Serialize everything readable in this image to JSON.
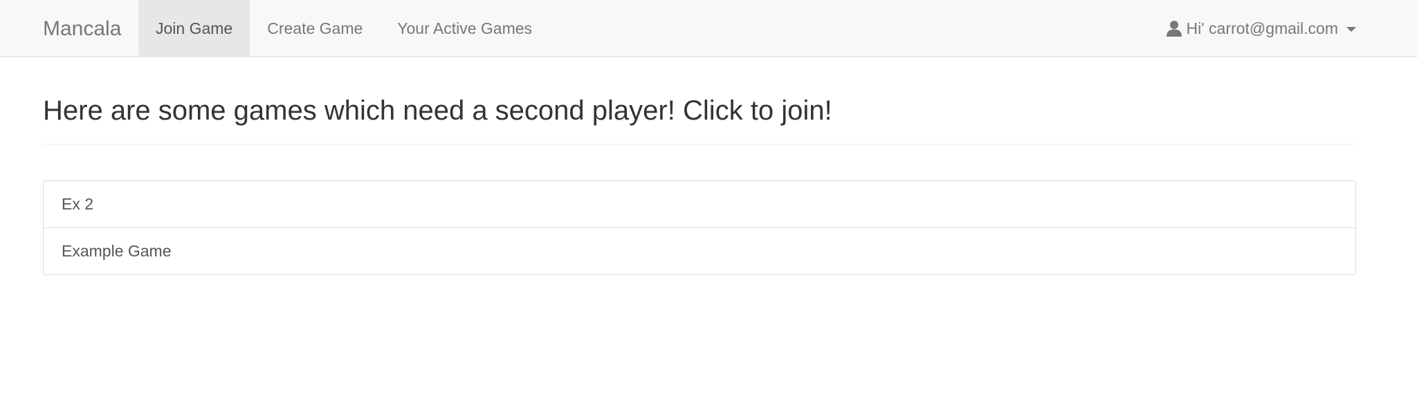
{
  "navbar": {
    "brand": "Mancala",
    "tabs": [
      {
        "label": "Join Game",
        "active": true
      },
      {
        "label": "Create Game",
        "active": false
      },
      {
        "label": "Your Active Games",
        "active": false
      }
    ],
    "user": {
      "greeting": "Hi' carrot@gmail.com",
      "icon": "user-icon",
      "dropdown_icon": "caret-down-icon"
    }
  },
  "main": {
    "title": "Here are some games which need a second player! Click to join!",
    "games": [
      {
        "name": "Ex 2"
      },
      {
        "name": "Example Game"
      }
    ]
  },
  "colors": {
    "navbar_bg": "#f8f8f8",
    "active_tab_bg": "#e7e7e7",
    "nav_text": "#777777",
    "title_text": "#333333"
  }
}
